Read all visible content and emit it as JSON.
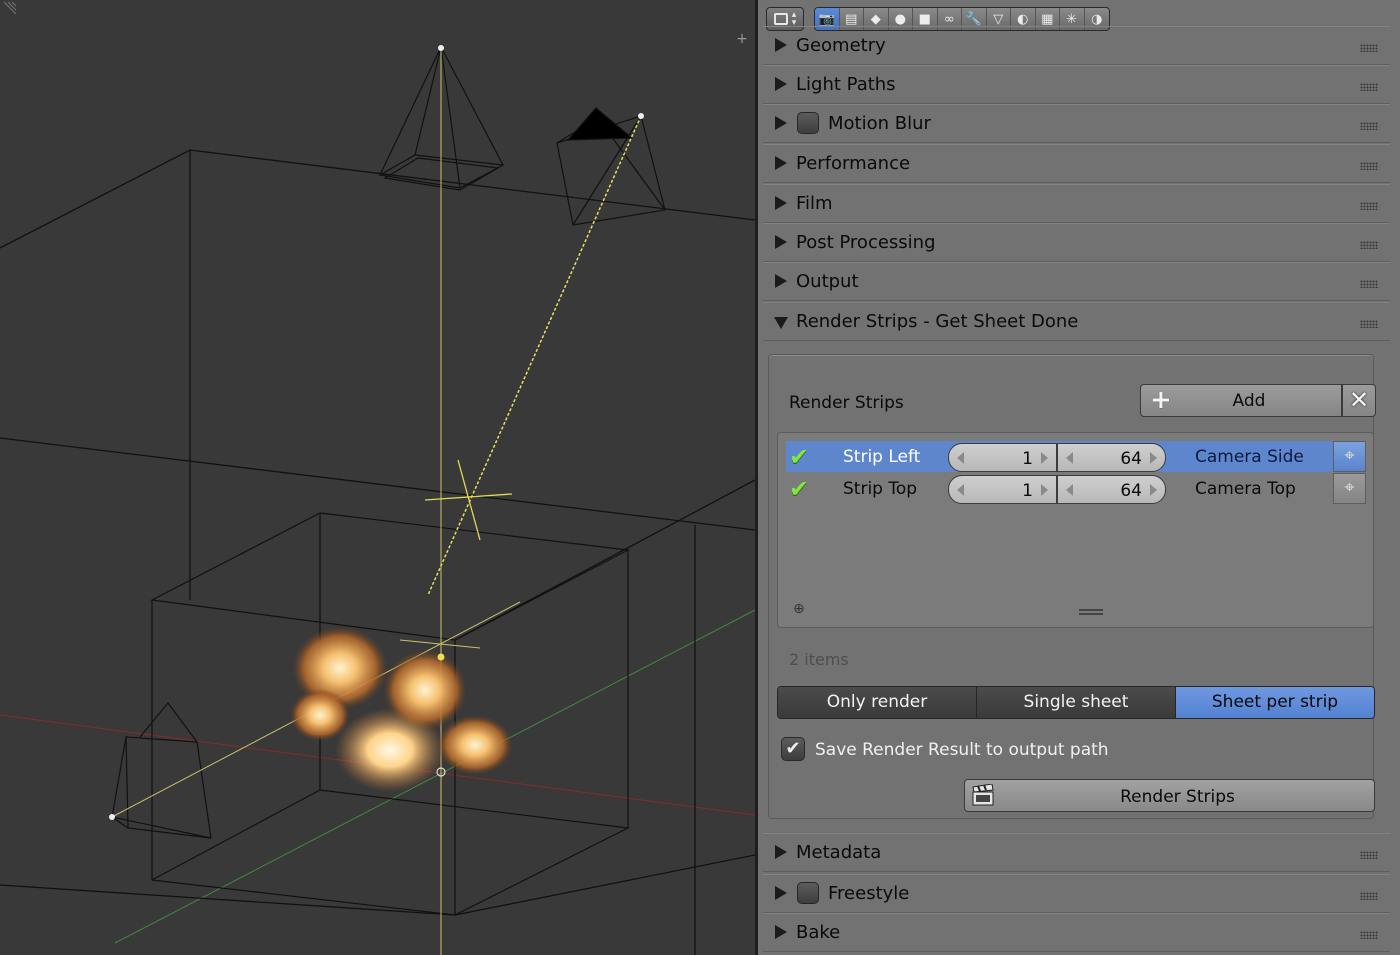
{
  "header": {
    "editor_type_icon": "properties-editor-icon",
    "context_tabs": [
      {
        "icon": "render-icon",
        "active": true
      },
      {
        "icon": "render-layers-icon",
        "active": false
      },
      {
        "icon": "scene-icon",
        "active": false
      },
      {
        "icon": "world-icon",
        "active": false
      },
      {
        "icon": "object-icon",
        "active": false
      },
      {
        "icon": "constraints-icon",
        "active": false
      },
      {
        "icon": "modifiers-icon",
        "active": false
      },
      {
        "icon": "data-icon",
        "active": false
      },
      {
        "icon": "material-icon",
        "active": false
      },
      {
        "icon": "texture-icon",
        "active": false
      },
      {
        "icon": "particles-icon",
        "active": false
      },
      {
        "icon": "physics-icon",
        "active": false
      }
    ]
  },
  "panels_top": [
    {
      "label": "Geometry",
      "has_checkbox": false
    },
    {
      "label": "Light Paths",
      "has_checkbox": false
    },
    {
      "label": "Motion Blur",
      "has_checkbox": true
    },
    {
      "label": "Performance",
      "has_checkbox": false
    },
    {
      "label": "Film",
      "has_checkbox": false
    },
    {
      "label": "Post Processing",
      "has_checkbox": false
    },
    {
      "label": "Output",
      "has_checkbox": false
    },
    {
      "label": "Render Strips - Get Sheet Done",
      "has_checkbox": false
    }
  ],
  "render_strips": {
    "title": "Render Strips",
    "add_label": "Add",
    "remove_symbol": "✕",
    "strips": [
      {
        "name": "Strip Left",
        "start": "1",
        "end": "64",
        "camera": "Camera Side",
        "enabled": true,
        "selected": true
      },
      {
        "name": "Strip Top",
        "start": "1",
        "end": "64",
        "camera": "Camera Top",
        "enabled": true,
        "selected": false
      }
    ],
    "items_count": "2 items",
    "modes": [
      "Only render",
      "Single sheet",
      "Sheet per strip"
    ],
    "active_mode": "Sheet per strip",
    "save_label": "Save Render Result to output path",
    "save_checked": true,
    "render_button": "Render Strips"
  },
  "panels_bottom": [
    {
      "label": "Metadata",
      "has_checkbox": false
    },
    {
      "label": "Freestyle",
      "has_checkbox": true
    },
    {
      "label": "Bake",
      "has_checkbox": false
    }
  ],
  "colors": {
    "selection_blue": "#5e86cc",
    "check_green": "#7ee840",
    "viewport_bg": "#393939"
  }
}
